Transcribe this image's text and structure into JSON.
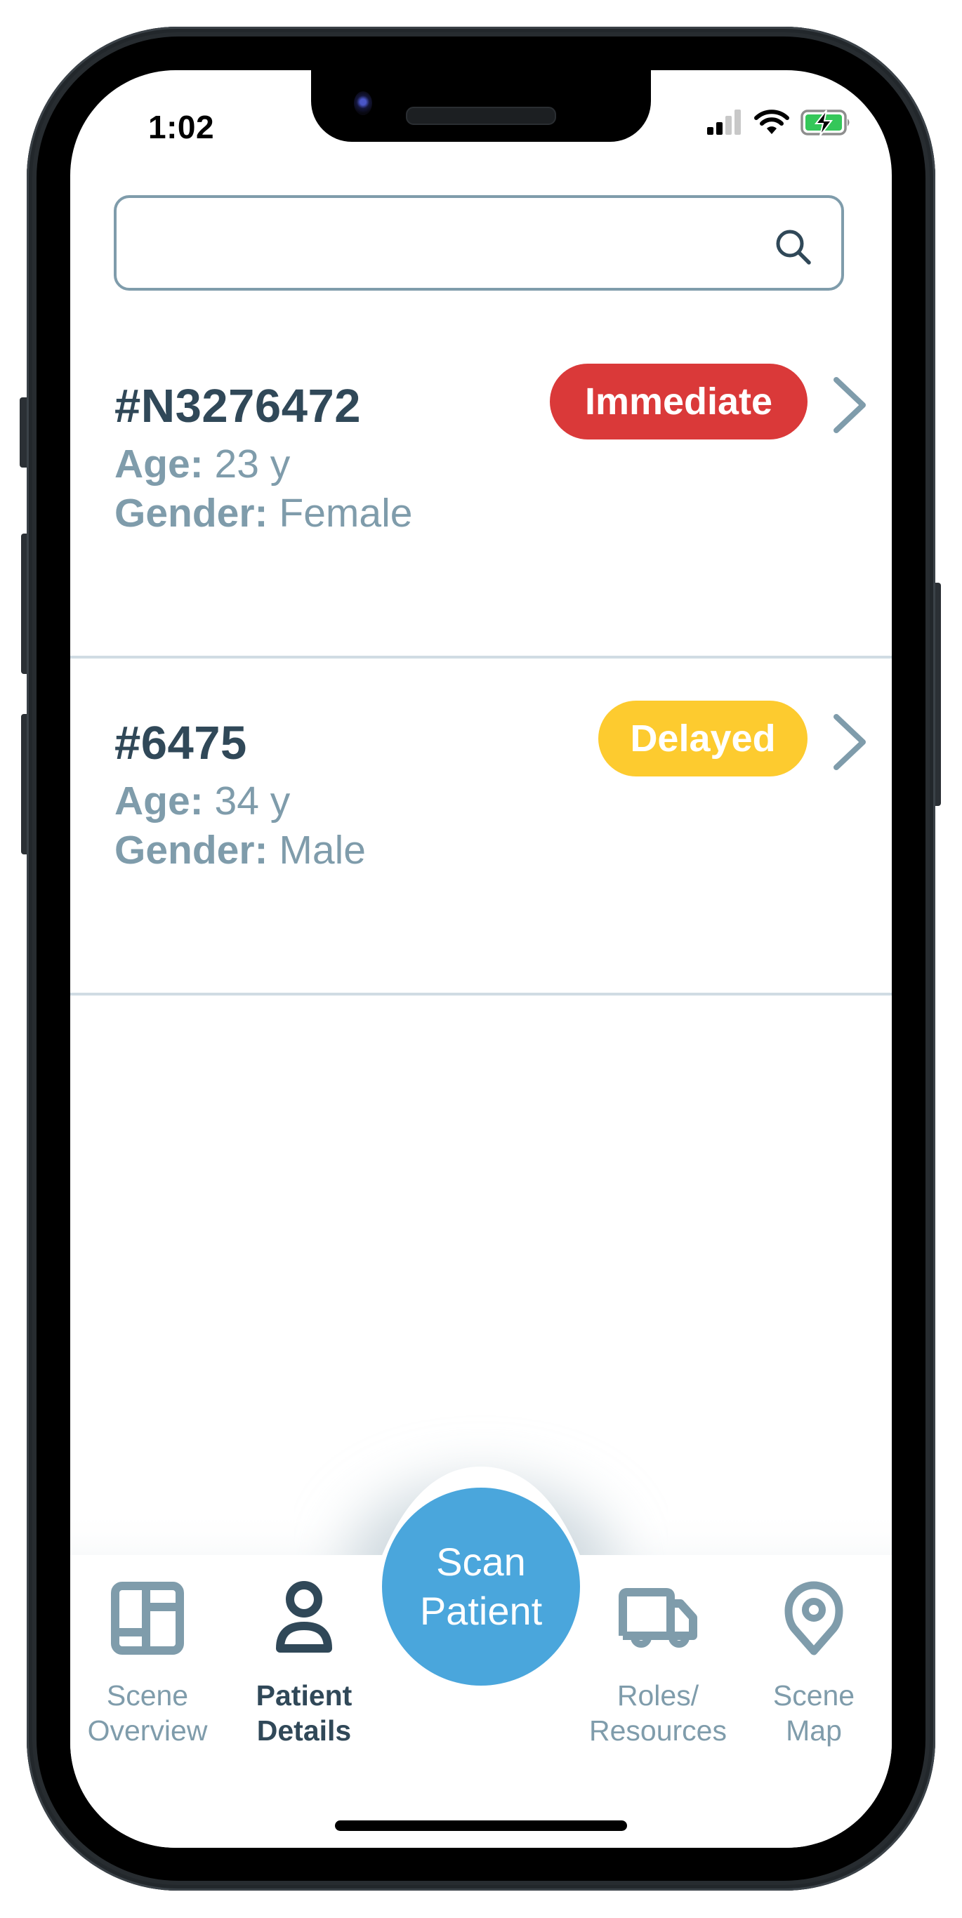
{
  "status_bar": {
    "time": "1:02",
    "signal_bars_active": 2,
    "signal_bars_total": 4,
    "wifi": "wifi-icon",
    "battery": "battery-charging-icon",
    "battery_color": "#34c759"
  },
  "search": {
    "value": "",
    "placeholder": "",
    "icon": "search-icon"
  },
  "patients": [
    {
      "id": "#N3276472",
      "age_label": "Age:",
      "age_value": "23 y",
      "gender_label": "Gender:",
      "gender_value": "Female",
      "status": "Immediate",
      "status_color": "#da3939"
    },
    {
      "id": "#6475",
      "age_label": "Age:",
      "age_value": "34 y",
      "gender_label": "Gender:",
      "gender_value": "Male",
      "status": "Delayed",
      "status_color": "#fdcb2f"
    }
  ],
  "nav": {
    "items": [
      {
        "line1": "Scene",
        "line2": "Overview",
        "icon": "layout-icon",
        "active": false
      },
      {
        "line1": "Patient",
        "line2": "Details",
        "icon": "person-icon",
        "active": true
      },
      {
        "line1": "Roles/",
        "line2": "Resources",
        "icon": "truck-icon",
        "active": false
      },
      {
        "line1": "Scene",
        "line2": "Map",
        "icon": "map-pin-icon",
        "active": false
      }
    ],
    "scan_button": {
      "line1": "Scan",
      "line2": "Patient"
    },
    "colors": {
      "active": "#304858",
      "inactive": "#7f9cab",
      "scan": "#4aa6dc"
    }
  }
}
